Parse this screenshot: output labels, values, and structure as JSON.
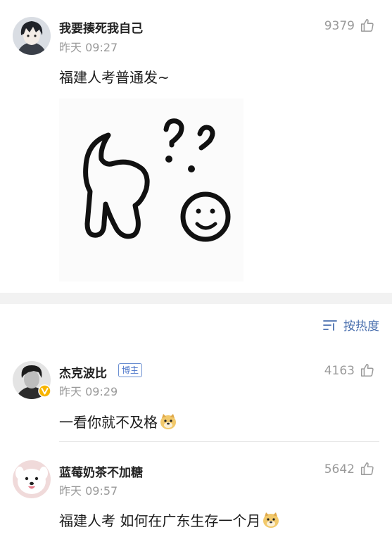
{
  "post": {
    "username": "我要揍死我自己",
    "timestamp": "昨天 09:27",
    "likes": "9379",
    "text": "福建人考普通发~",
    "avatar_icon": "anime-boy-avatar",
    "sticker_icon": "confused-cat-doodle-sticker"
  },
  "sort": {
    "label": "按热度",
    "icon": "sort-lines-icon",
    "color": "#4a6fae"
  },
  "comments": [
    {
      "username": "杰克波比",
      "badge": "博主",
      "timestamp": "昨天 09:29",
      "likes": "4163",
      "text": "一看你就不及格",
      "emoji": "doge-emoji",
      "avatar_icon": "grayscale-man-avatar",
      "verified_icon": "verified-v-badge-icon"
    },
    {
      "username": "蓝莓奶茶不加糖",
      "timestamp": "昨天 09:57",
      "likes": "5642",
      "text": "福建人考 如何在广东生存一个月",
      "emoji": "doge-emoji",
      "avatar_icon": "white-dog-avatar"
    }
  ]
}
